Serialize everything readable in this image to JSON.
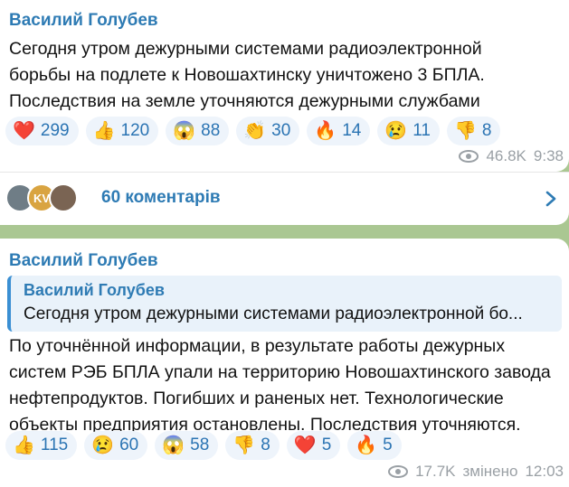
{
  "message1": {
    "author": "Василий Голубев",
    "lines": [
      "Сегодня утром дежурными системами радиоэлектронной",
      "борьбы на подлете к Новошахтинску уничтожено 3 БПЛА.",
      "Последствия на земле уточняются дежурными службами"
    ],
    "reactions": [
      {
        "emoji": "❤️",
        "count": "299"
      },
      {
        "emoji": "👍",
        "count": "120"
      },
      {
        "emoji": "😱",
        "count": "88"
      },
      {
        "emoji": "👏",
        "count": "30"
      },
      {
        "emoji": "🔥",
        "count": "14"
      },
      {
        "emoji": "😢",
        "count": "11"
      },
      {
        "emoji": "👎",
        "count": "8"
      }
    ],
    "views": "46.8K",
    "time": "9:38"
  },
  "comments": {
    "label": "60 коментарів",
    "avatar_text": "KV"
  },
  "message2": {
    "author": "Василий Голубев",
    "quote": {
      "author": "Василий Голубев",
      "text": "Сегодня утром дежурными системами радиоэлектронной бо..."
    },
    "lines": [
      "По уточнённой информации, в результате работы дежурных",
      "систем РЭБ БПЛА упали на территорию Новошахтинского завода",
      "нефтепродуктов. Погибших и раненых нет. Технологические",
      "объекты предприятия остановлены. Последствия уточняются."
    ],
    "reactions": [
      {
        "emoji": "👍",
        "count": "115"
      },
      {
        "emoji": "😢",
        "count": "60"
      },
      {
        "emoji": "😱",
        "count": "58"
      },
      {
        "emoji": "👎",
        "count": "8"
      },
      {
        "emoji": "❤️",
        "count": "5"
      },
      {
        "emoji": "🔥",
        "count": "5"
      }
    ],
    "views": "17.7K",
    "edited_label": "змінено",
    "time": "12:03"
  },
  "colors": {
    "accent": "#2e7bb4",
    "reaction_bg": "#eef4fb",
    "wallpaper": "#aac792"
  }
}
